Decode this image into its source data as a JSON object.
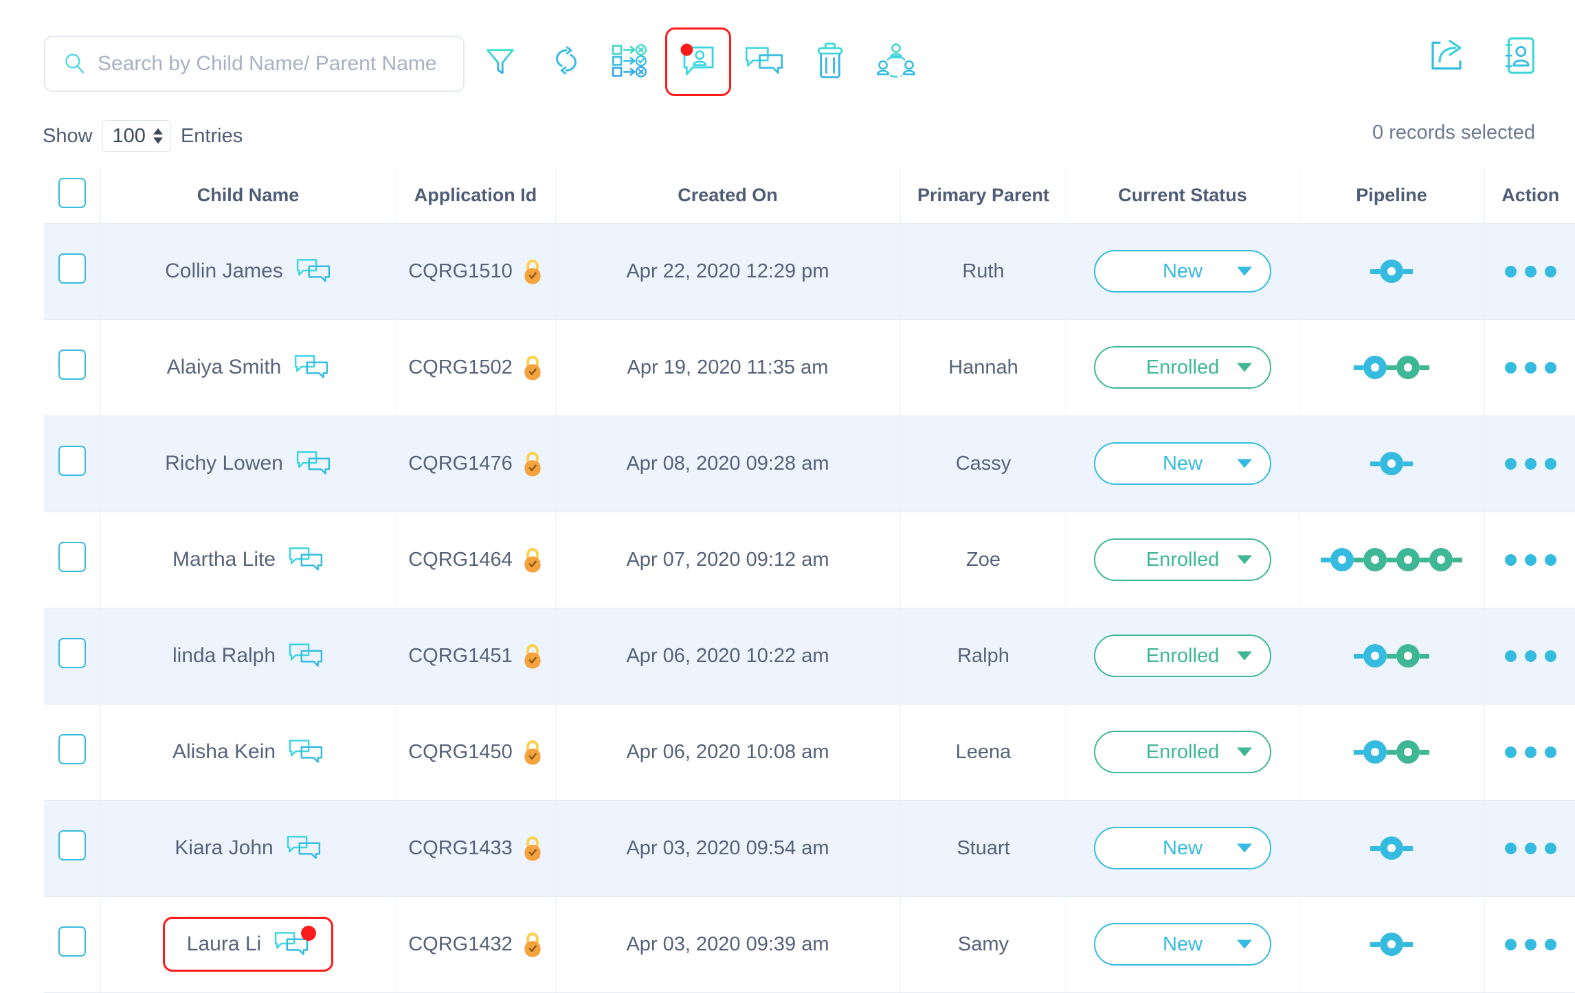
{
  "toolbar": {
    "search": {
      "placeholder": "Search by Child Name/ Parent Name",
      "value": ""
    },
    "icons": [
      {
        "name": "filter-icon",
        "label": "Filter"
      },
      {
        "name": "refresh-icon",
        "label": "Refresh"
      },
      {
        "name": "bulk-status-icon",
        "label": "Bulk Status Update"
      },
      {
        "name": "message-parent-icon",
        "label": "Message Parent",
        "highlighted": true,
        "badge": true
      },
      {
        "name": "chat-icon",
        "label": "Chat"
      },
      {
        "name": "trash-icon",
        "label": "Delete"
      },
      {
        "name": "assign-staff-icon",
        "label": "Assign Staff"
      }
    ],
    "right_icons": [
      {
        "name": "export-icon",
        "label": "Export"
      },
      {
        "name": "contact-card-icon",
        "label": "Contacts"
      }
    ]
  },
  "entries": {
    "show_label": "Show",
    "count": "100",
    "entries_label": "Entries",
    "records_selected": "0 records selected"
  },
  "table": {
    "columns": [
      "Child Name",
      "Application Id",
      "Created On",
      "Primary Parent",
      "Current Status",
      "Pipeline",
      "Action"
    ],
    "rows": [
      {
        "child_name": "Collin James",
        "application_id": "CQRG1510",
        "created_on": "Apr 22, 2020 12:29 pm",
        "primary_parent": "Ruth",
        "status": "New",
        "status_color": "blue",
        "pipeline": [
          "blue"
        ],
        "selected": false,
        "highlighted": false,
        "badge": false
      },
      {
        "child_name": "Alaiya Smith",
        "application_id": "CQRG1502",
        "created_on": "Apr 19, 2020 11:35 am",
        "primary_parent": "Hannah",
        "status": "Enrolled",
        "status_color": "green",
        "pipeline": [
          "blue",
          "green"
        ],
        "selected": false,
        "highlighted": false,
        "badge": false
      },
      {
        "child_name": "Richy Lowen",
        "application_id": "CQRG1476",
        "created_on": "Apr 08, 2020 09:28 am",
        "primary_parent": "Cassy",
        "status": "New",
        "status_color": "blue",
        "pipeline": [
          "blue"
        ],
        "selected": false,
        "highlighted": false,
        "badge": false
      },
      {
        "child_name": "Martha Lite",
        "application_id": "CQRG1464",
        "created_on": "Apr 07, 2020 09:12 am",
        "primary_parent": "Zoe",
        "status": "Enrolled",
        "status_color": "green",
        "pipeline": [
          "blue",
          "green",
          "green",
          "green"
        ],
        "selected": false,
        "highlighted": false,
        "badge": false
      },
      {
        "child_name": "linda Ralph",
        "application_id": "CQRG1451",
        "created_on": "Apr 06, 2020 10:22 am",
        "primary_parent": "Ralph",
        "status": "Enrolled",
        "status_color": "green",
        "pipeline": [
          "blue",
          "green"
        ],
        "selected": false,
        "highlighted": false,
        "badge": false
      },
      {
        "child_name": "Alisha Kein",
        "application_id": "CQRG1450",
        "created_on": "Apr 06, 2020 10:08 am",
        "primary_parent": "Leena",
        "status": "Enrolled",
        "status_color": "green",
        "pipeline": [
          "blue",
          "green"
        ],
        "selected": false,
        "highlighted": false,
        "badge": false
      },
      {
        "child_name": "Kiara John",
        "application_id": "CQRG1433",
        "created_on": "Apr 03, 2020 09:54 am",
        "primary_parent": "Stuart",
        "status": "New",
        "status_color": "blue",
        "pipeline": [
          "blue"
        ],
        "selected": false,
        "highlighted": false,
        "badge": false
      },
      {
        "child_name": "Laura Li",
        "application_id": "CQRG1432",
        "created_on": "Apr 03, 2020 09:39 am",
        "primary_parent": "Samy",
        "status": "New",
        "status_color": "blue",
        "pipeline": [
          "blue"
        ],
        "selected": false,
        "highlighted": true,
        "badge": true
      }
    ]
  },
  "colors": {
    "accent_blue": "#36bbe0",
    "accent_green": "#3fb795",
    "highlight_red": "#ff1a1a",
    "lock_orange": "#f5a33c",
    "row_stripe": "#eef4fd",
    "text": "#55627a"
  }
}
